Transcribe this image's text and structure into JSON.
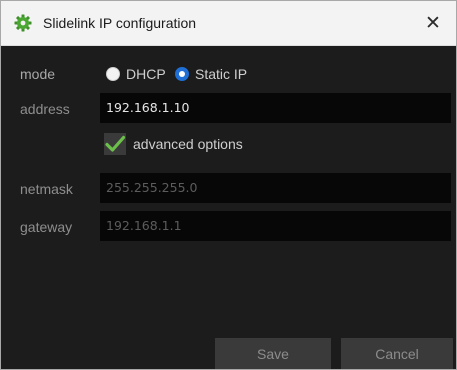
{
  "window": {
    "title": "Slidelink IP configuration",
    "close_glyph": "✕",
    "app_icon": "gear-icon",
    "close_icon": "close-icon"
  },
  "form": {
    "mode": {
      "label": "mode",
      "options": [
        {
          "label": "DHCP",
          "selected": false
        },
        {
          "label": "Static IP",
          "selected": true
        }
      ]
    },
    "address": {
      "label": "address",
      "value": "192.168.1.10"
    },
    "advanced": {
      "label": "advanced options",
      "checked": true,
      "icon": "checkmark-icon"
    },
    "netmask": {
      "label": "netmask",
      "value": "255.255.255.0"
    },
    "gateway": {
      "label": "gateway",
      "value": "192.168.1.1"
    }
  },
  "buttons": {
    "save": "Save",
    "cancel": "Cancel"
  },
  "colors": {
    "background": "#1c1c1c",
    "field": "#070707",
    "accent": "#1f6fd6",
    "check": "#6cc04a",
    "button": "#3a3a3a",
    "titlebar": "#f3f3f3"
  }
}
